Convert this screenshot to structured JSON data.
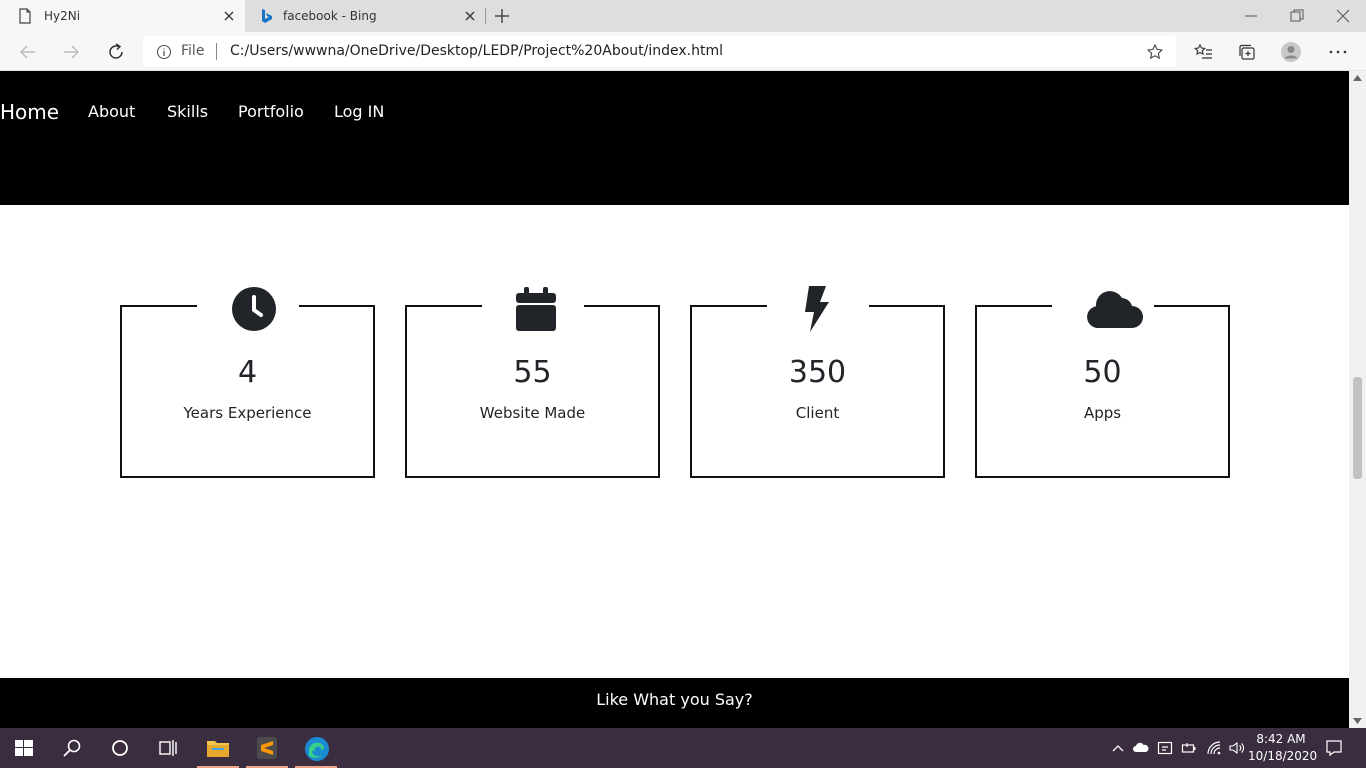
{
  "browser": {
    "tabs": [
      {
        "title": "Hy2Ni",
        "active": true
      },
      {
        "title": "facebook - Bing",
        "active": false
      }
    ],
    "address": {
      "scheme_label": "File",
      "url": "C:/Users/wwwna/OneDrive/Desktop/LEDP/Project%20About/index.html"
    }
  },
  "site": {
    "nav": [
      {
        "label": "Home"
      },
      {
        "label": "About"
      },
      {
        "label": "Skills"
      },
      {
        "label": "Portfolio"
      },
      {
        "label": "Log IN"
      }
    ],
    "stats": [
      {
        "icon": "clock-icon",
        "number": "4",
        "label": "Years Experience"
      },
      {
        "icon": "calendar-icon",
        "number": "55",
        "label": "Website Made"
      },
      {
        "icon": "lightning-icon",
        "number": "350",
        "label": "Client"
      },
      {
        "icon": "cloud-icon",
        "number": "50",
        "label": "Apps"
      }
    ],
    "footer_text": "Like What you Say?"
  },
  "taskbar": {
    "time": "8:42 AM",
    "date": "10/18/2020"
  },
  "colors": {
    "header_bg": "#000000",
    "taskbar_bg": "#3a2d3f",
    "icon_dark": "#212529",
    "accent_underline": "#f0a48a"
  }
}
